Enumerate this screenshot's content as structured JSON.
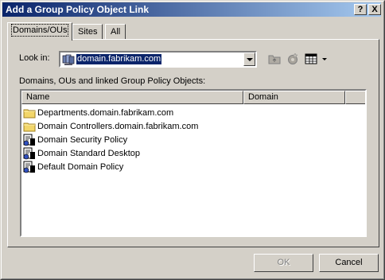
{
  "window": {
    "title": "Add a Group Policy Object Link"
  },
  "title_buttons": {
    "help": "?",
    "close": "X"
  },
  "tabs": [
    {
      "label": "Domains/OUs"
    },
    {
      "label": "Sites"
    },
    {
      "label": "All"
    }
  ],
  "look_in": {
    "label": "Look in:",
    "value": "domain.fabrikam.com"
  },
  "toolbar_icons": [
    "up-folder-icon",
    "new-gpo-icon",
    "view-menu-icon"
  ],
  "list_caption": "Domains, OUs and linked Group Policy Objects:",
  "list": {
    "columns": [
      "Name",
      "Domain"
    ],
    "rows": [
      {
        "icon": "folder-icon",
        "name": "Departments.domain.fabrikam.com"
      },
      {
        "icon": "folder-icon",
        "name": "Domain Controllers.domain.fabrikam.com"
      },
      {
        "icon": "gpo-icon",
        "name": "Domain Security Policy"
      },
      {
        "icon": "gpo-icon",
        "name": "Domain Standard Desktop"
      },
      {
        "icon": "gpo-icon",
        "name": "Default Domain Policy"
      }
    ]
  },
  "buttons": {
    "ok": "OK",
    "cancel": "Cancel"
  },
  "colors": {
    "titlebar_start": "#0a246a",
    "titlebar_end": "#a6caf0",
    "selection": "#0a246a",
    "dialog_face": "#d4d0c8"
  }
}
